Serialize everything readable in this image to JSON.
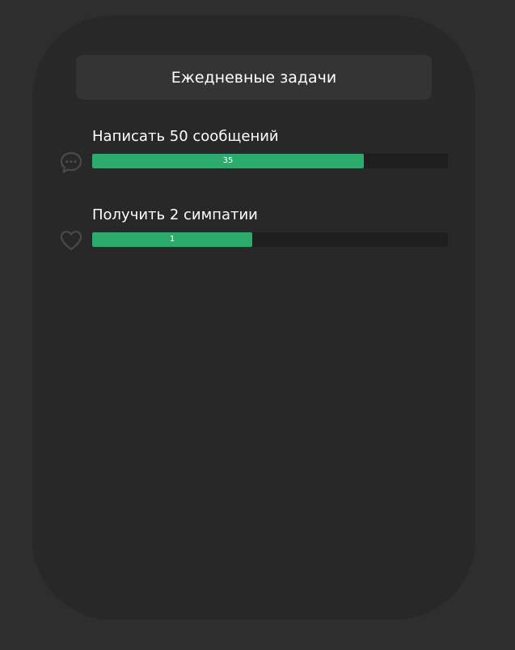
{
  "header": {
    "title": "Ежедневные задачи"
  },
  "tasks": [
    {
      "title": "Написать 50 сообщений",
      "icon": "chat-bubble-icon",
      "progress_label": "35",
      "progress_fraction": 0.764
    },
    {
      "title": "Получить 2 симпатии",
      "icon": "heart-icon",
      "progress_label": "1",
      "progress_fraction": 0.45
    }
  ],
  "colors": {
    "background": "#2e2e2e",
    "panel": "#282828",
    "header": "#343434",
    "accent": "#2bab6c",
    "track": "#1e1e1e"
  }
}
